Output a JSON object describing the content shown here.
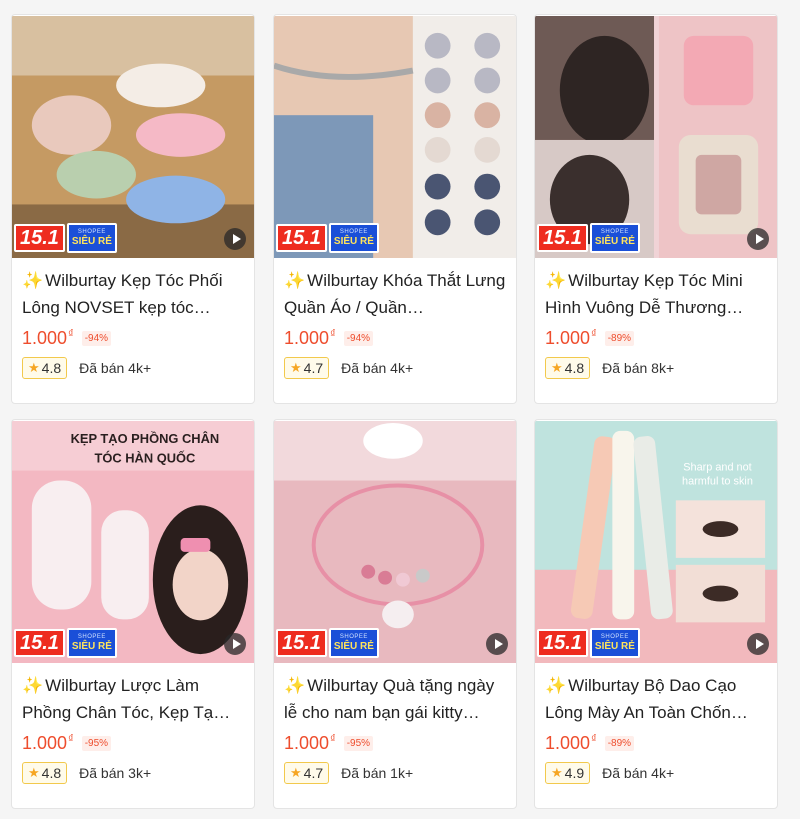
{
  "colors": {
    "accent": "#ee4d2d",
    "badge_red": "#ee2c1f",
    "badge_blue": "#1a4fd8",
    "star": "#f6a623"
  },
  "badge": {
    "promo": "15.1",
    "sieu_re_top": "SHOPEE",
    "sieu_re": "SIÊU RẺ"
  },
  "products": [
    {
      "title": "Wilburtay Kẹp Tóc Phối Lông NOVSET kẹp tóc…",
      "price": "1.000",
      "currency": "₫",
      "discount": "-94%",
      "rating": "4.8",
      "sold": "Đã bán 4k+",
      "icon": "video-play-icon"
    },
    {
      "title": "Wilburtay Khóa Thắt Lưng Quần Áo / Quần…",
      "price": "1.000",
      "currency": "₫",
      "discount": "-94%",
      "rating": "4.7",
      "sold": "Đã bán 4k+",
      "icon": "video-play-icon"
    },
    {
      "title": "Wilburtay Kẹp Tóc Mini Hình Vuông Dễ Thương…",
      "price": "1.000",
      "currency": "₫",
      "discount": "-89%",
      "rating": "4.8",
      "sold": "Đã bán 8k+",
      "icon": "video-play-icon"
    },
    {
      "title": "Wilburtay Lược Làm Phồng Chân Tóc, Kẹp Tạ…",
      "price": "1.000",
      "currency": "₫",
      "discount": "-95%",
      "rating": "4.8",
      "sold": "Đã bán 3k+",
      "icon": "video-play-icon",
      "image_text": [
        "KẸP TẠO PHỒNG CHÂN",
        "TÓC HÀN QUỐC"
      ]
    },
    {
      "title": "Wilburtay Quà tặng ngày lễ cho nam bạn gái kitty…",
      "price": "1.000",
      "currency": "₫",
      "discount": "-95%",
      "rating": "4.7",
      "sold": "Đã bán 1k+",
      "icon": "video-play-icon"
    },
    {
      "title": "Wilburtay Bộ Dao Cạo Lông Mày An Toàn Chốn…",
      "price": "1.000",
      "currency": "₫",
      "discount": "-89%",
      "rating": "4.9",
      "sold": "Đã bán 4k+",
      "icon": "video-play-icon",
      "image_text": [
        "Sharp and not",
        "harmful to skin"
      ]
    }
  ]
}
